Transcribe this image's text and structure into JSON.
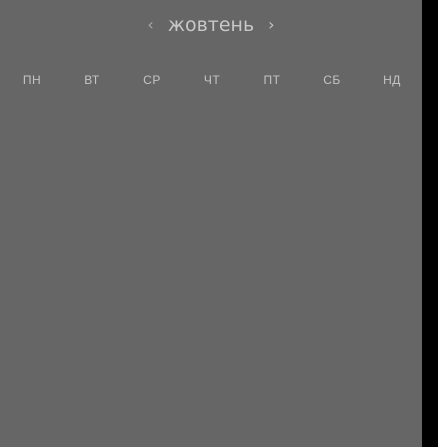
{
  "calendar": {
    "month": "жовтень",
    "prev_icon": "chevron-left-icon",
    "next_icon": "chevron-right-icon",
    "weekdays": [
      "ПН",
      "ВТ",
      "СР",
      "ЧТ",
      "ПТ",
      "СБ",
      "НД"
    ]
  },
  "colors": {
    "panel_background": "#666666",
    "outer_background": "#000000",
    "text": "#c6c6c6"
  }
}
